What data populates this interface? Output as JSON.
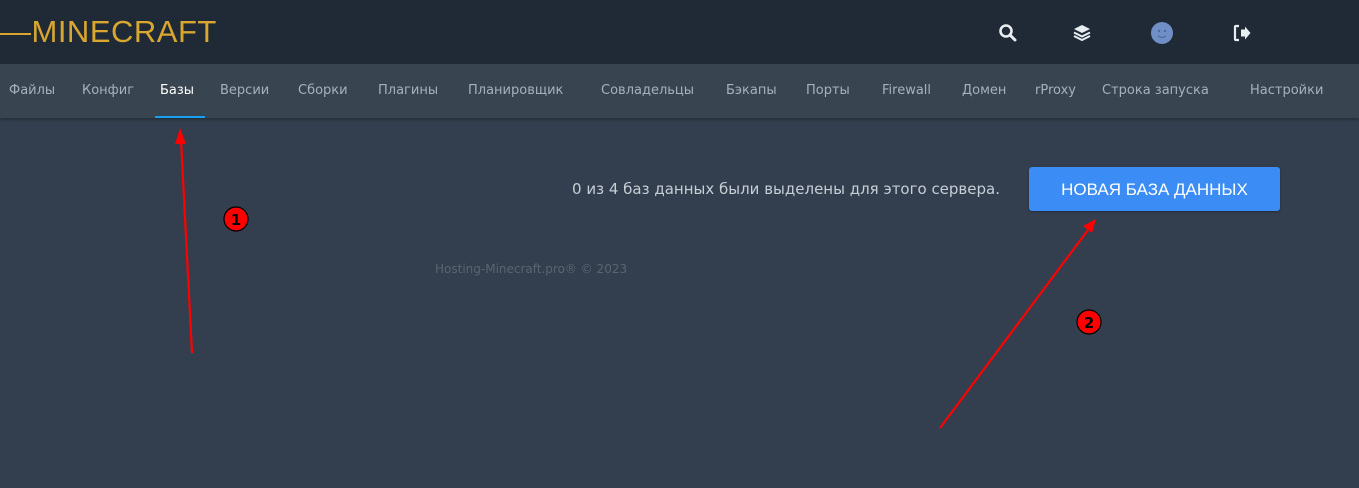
{
  "header": {
    "logo_text": "—MINECRAFT",
    "icons": [
      "search-icon",
      "layers-icon",
      "avatar",
      "logout-icon"
    ]
  },
  "nav": {
    "items": [
      {
        "label": "Файлы"
      },
      {
        "label": "Конфиг"
      },
      {
        "label": "Базы",
        "active": true
      },
      {
        "label": "Версии"
      },
      {
        "label": "Сборки"
      },
      {
        "label": "Плагины"
      },
      {
        "label": "Планировщик"
      },
      {
        "label": "Совладельцы"
      },
      {
        "label": "Бэкапы"
      },
      {
        "label": "Порты"
      },
      {
        "label": "Firewall"
      },
      {
        "label": "Домен"
      },
      {
        "label": "rProxy"
      },
      {
        "label": "Строка запуска"
      },
      {
        "label": "Настройки"
      }
    ]
  },
  "main": {
    "db_summary": "0 из 4 баз данных были выделены для этого сервера.",
    "new_db_button": "НОВАЯ БАЗА ДАННЫХ"
  },
  "footer": {
    "text": "Hosting-Minecraft.pro® © 2023"
  },
  "annotations": {
    "marker_1": "1",
    "marker_2": "2"
  },
  "colors": {
    "accent": "#3b8cf5",
    "logo": "#d9a72f",
    "active_tab_underline": "#1a9ff0",
    "annotation": "#ff0000"
  }
}
